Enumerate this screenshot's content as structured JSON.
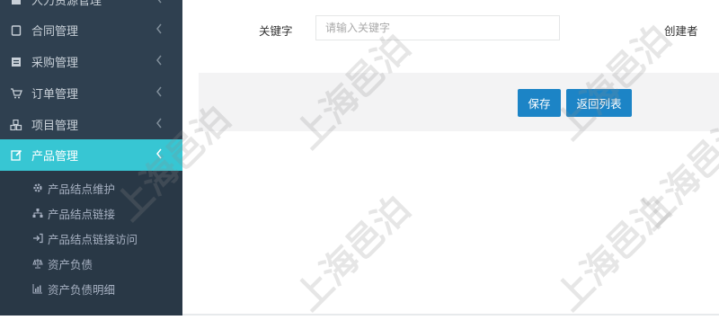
{
  "sidebar": {
    "items": [
      {
        "label": "人力资源管理",
        "icon": "document-icon"
      },
      {
        "label": "合同管理",
        "icon": "file-icon"
      },
      {
        "label": "采购管理",
        "icon": "list-icon"
      },
      {
        "label": "订单管理",
        "icon": "cart-icon"
      },
      {
        "label": "项目管理",
        "icon": "cubes-icon"
      },
      {
        "label": "产品管理",
        "icon": "edit-icon"
      }
    ],
    "active_index": 5,
    "submenu": [
      {
        "label": "产品结点维护",
        "icon": "gear-icon"
      },
      {
        "label": "产品结点链接",
        "icon": "sitemap-icon"
      },
      {
        "label": "产品结点链接访问",
        "icon": "sign-in-icon"
      },
      {
        "label": "资产负债",
        "icon": "balance-icon"
      },
      {
        "label": "资产负债明细",
        "icon": "bar-chart-icon"
      }
    ],
    "colors": {
      "bg": "#2f4050",
      "active": "#37c6d3",
      "submenu_bg": "#293846"
    }
  },
  "form": {
    "keyword_label": "关键字",
    "keyword_placeholder": "请输入关键字",
    "keyword_value": "",
    "creator_label": "创建者"
  },
  "actions": {
    "save_label": "保存",
    "back_label": "返回列表",
    "button_color": "#1c84c6"
  },
  "watermark": {
    "text": "上海邑泊"
  }
}
